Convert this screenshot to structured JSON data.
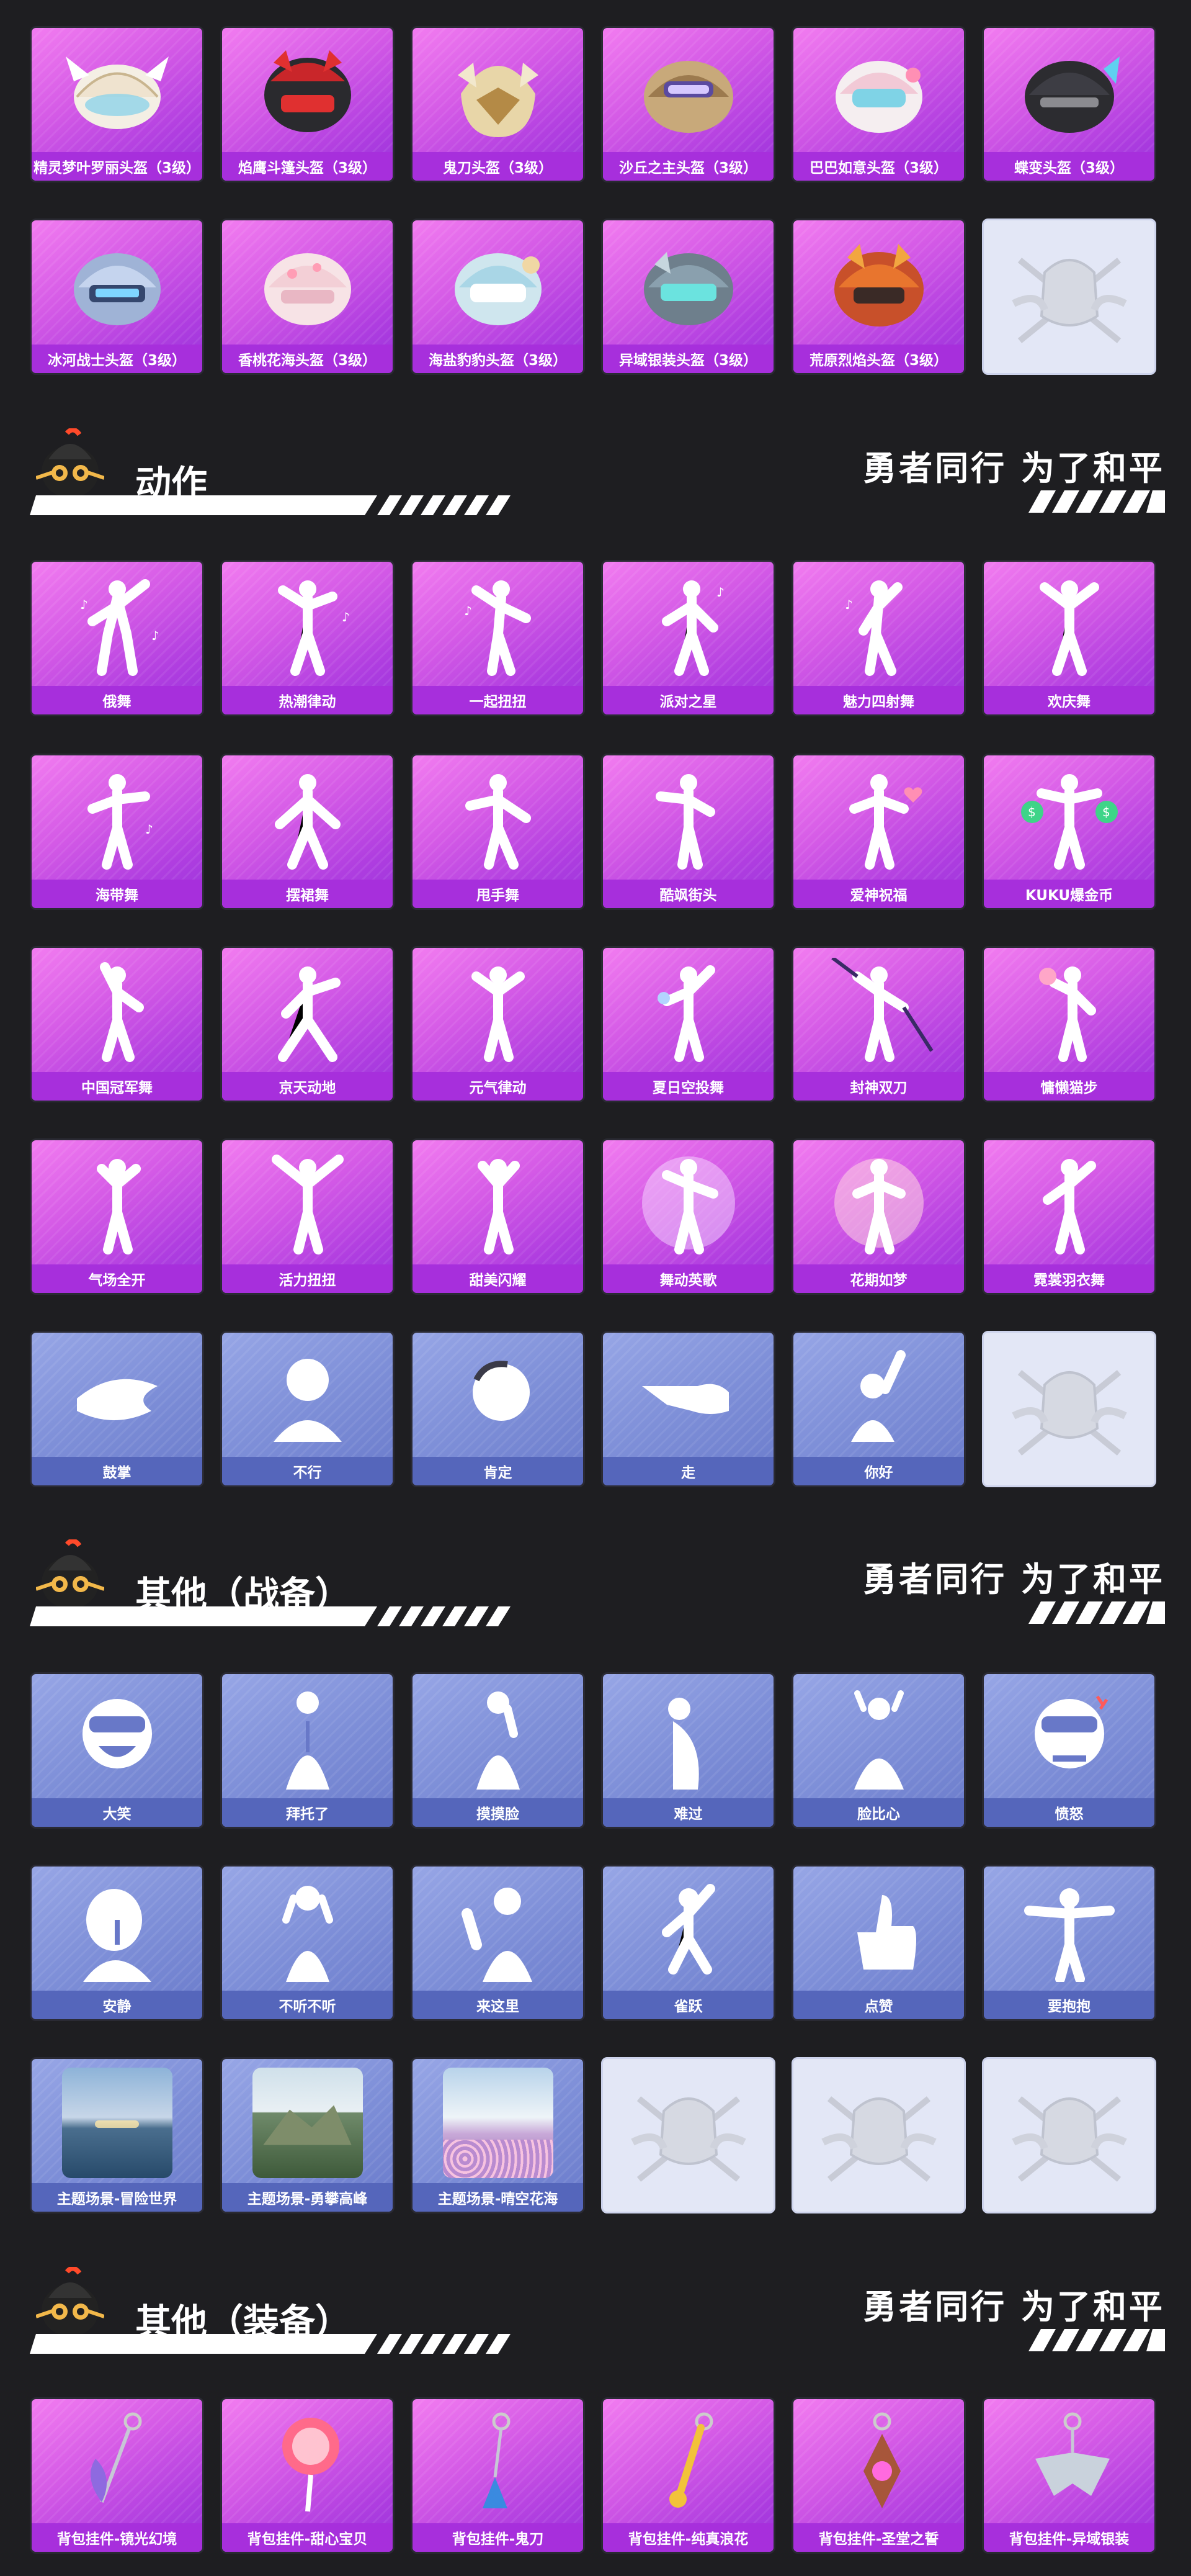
{
  "slogan": "勇者同行 为了和平",
  "sections": {
    "dongzuo": "动作",
    "zhanbei": "其他（战备）",
    "zhuangbei": "其他（装备）"
  },
  "helmets": [
    [
      "精灵梦叶罗丽头盔（3级）",
      "焰鹰斗篷头盔（3级）",
      "鬼刀头盔（3级）",
      "沙丘之主头盔（3级）",
      "巴巴如意头盔（3级）",
      "蝶变头盔（3级）"
    ],
    [
      "冰河战士头盔（3级）",
      "香桃花海头盔（3级）",
      "海盐豹豹头盔（3级）",
      "异域银装头盔（3级）",
      "荒原烈焰头盔（3级）"
    ]
  ],
  "actions": [
    [
      "俄舞",
      "热潮律动",
      "一起扭扭",
      "派对之星",
      "魅力四射舞",
      "欢庆舞"
    ],
    [
      "海带舞",
      "摆裙舞",
      "甩手舞",
      "酷飒街头",
      "爱神祝福",
      "KUKU爆金币"
    ],
    [
      "中国冠军舞",
      "京天动地",
      "元气律动",
      "夏日空投舞",
      "封神双刀",
      "慵懒猫步"
    ],
    [
      "气场全开",
      "活力扭扭",
      "甜美闪耀",
      "舞动英歌",
      "花期如梦",
      "霓裳羽衣舞"
    ],
    [
      "鼓掌",
      "不行",
      "肯定",
      "走",
      "你好"
    ]
  ],
  "zhanbei": [
    [
      "大笑",
      "拜托了",
      "摸摸脸",
      "难过",
      "脸比心",
      "愤怒"
    ],
    [
      "安静",
      "不听不听",
      "来这里",
      "雀跃",
      "点赞",
      "要抱抱"
    ],
    [
      "主题场景-冒险世界",
      "主题场景-勇攀高峰",
      "主题场景-晴空花海"
    ]
  ],
  "zhuangbei": [
    [
      "背包挂件-镜光幻境",
      "背包挂件-甜心宝贝",
      "背包挂件-鬼刀",
      "背包挂件-纯真浪花",
      "背包挂件-圣堂之誓",
      "背包挂件-异域银装"
    ]
  ],
  "colors": {
    "background": "#1e1e21",
    "purple_card": "#c04ce4",
    "blue_card": "#7e8fd8",
    "empty_card": "#e3e7f6"
  }
}
